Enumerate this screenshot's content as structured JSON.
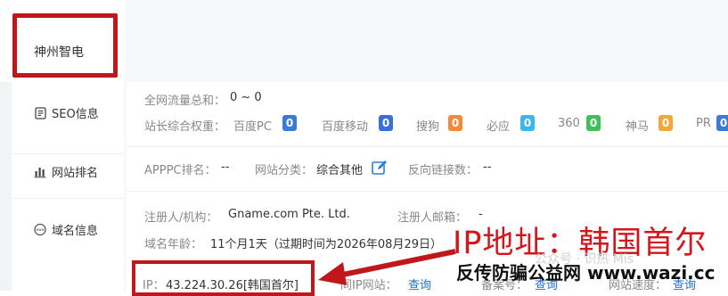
{
  "site": {
    "title": "神州智电"
  },
  "sidebar": {
    "items": [
      {
        "label": "SEO信息",
        "icon": "document-icon"
      },
      {
        "label": "网站排名",
        "icon": "bar-chart-icon"
      },
      {
        "label": "域名信息",
        "icon": "www-globe-icon"
      }
    ]
  },
  "seo": {
    "traffic_label": "全网流量总和：",
    "traffic_value": "0 ~ 0",
    "weight_label": "站长综合权重：",
    "engines": [
      {
        "name": "百度PC",
        "value": "0",
        "color": "#3a7bd5"
      },
      {
        "name": "百度移动",
        "value": "0",
        "color": "#3a6fd8"
      },
      {
        "name": "搜狗",
        "value": "0",
        "color": "#f08a3c"
      },
      {
        "name": "必应",
        "value": "0",
        "color": "#3db8e6"
      },
      {
        "name": "360",
        "value": "0",
        "color": "#41c05a"
      },
      {
        "name": "神马",
        "value": "0",
        "color": "#f0a838"
      },
      {
        "name": "PR",
        "value": "0",
        "color": "#3a7bd5"
      }
    ]
  },
  "rank": {
    "apppc_label": "APPPC排名：",
    "apppc_value": "--",
    "category_label": "网站分类：",
    "category_value": "综合其他",
    "backlinks_label": "反向链接数：",
    "backlinks_value": "--"
  },
  "domain": {
    "registrant_label": "注册人/机构：",
    "registrant_value": "Gname.com Pte. Ltd.",
    "email_label": "注册人邮箱：",
    "email_value": "-",
    "age_label": "域名年龄：",
    "age_value": "11个月1天（过期时间为2026年08月29日）",
    "ip_label": "IP：",
    "ip_value": "43.224.30.26[韩国首尔]",
    "same_ip_label": "同IP网站：",
    "same_ip_link": "查询",
    "icp_label": "备案号：",
    "icp_link": "查询",
    "speed_label": "网站速度：",
    "speed_link": "查询"
  },
  "annotations": {
    "ip_location": "IP地址：韩国首尔",
    "faint_text": "公众号 · 识热 Mis",
    "site_credit": "反传防骗公益网 www.wazi.cc",
    "accent_color": "#c0171c"
  }
}
